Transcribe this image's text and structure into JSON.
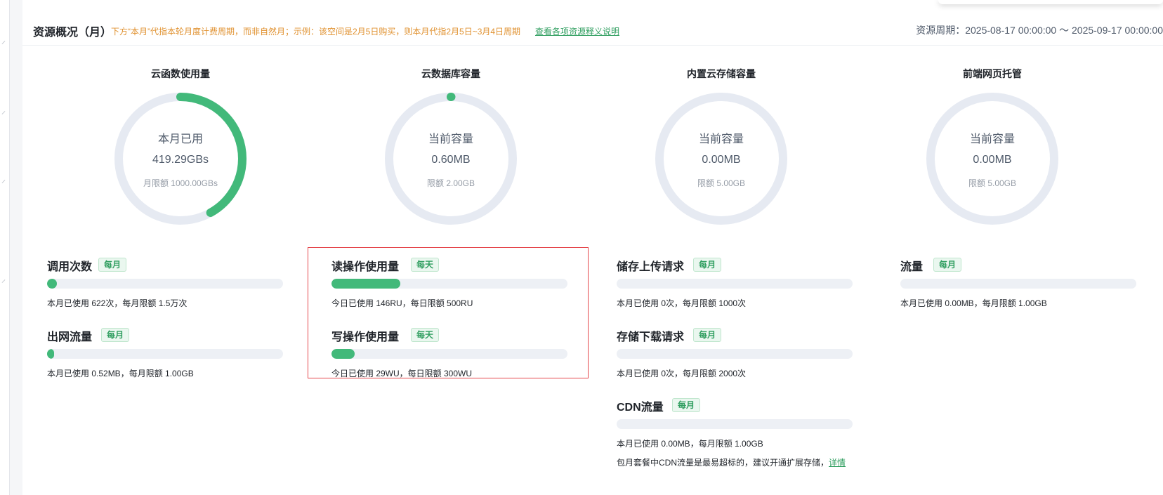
{
  "header": {
    "title": "资源概况（月）",
    "hint": "下方“本月”代指本轮月度计费周期，而非自然月；示例：该空间是2月5日购买，则本月代指2月5日~3月4日周期",
    "hint_link": "查看各项资源释义说明",
    "period": "资源周期：2025-08-17 00:00:00 ～ 2025-09-17 00:00:00"
  },
  "gauges": [
    {
      "title": "云函数使用量",
      "label": "本月已用",
      "value": "419.29GBs",
      "limit": "月限额 1000.00GBs",
      "fraction": 0.4193
    },
    {
      "title": "云数据库容量",
      "label": "当前容量",
      "value": "0.60MB",
      "limit": "限额 2.00GB",
      "fraction": 0.0003
    },
    {
      "title": "内置云存储容量",
      "label": "当前容量",
      "value": "0.00MB",
      "limit": "限额 5.00GB",
      "fraction": 0
    },
    {
      "title": "前端网页托管",
      "label": "当前容量",
      "value": "0.00MB",
      "limit": "限额 5.00GB",
      "fraction": 0
    }
  ],
  "metrics": {
    "calls": {
      "name": "调用次数",
      "badge": "每月",
      "desc": "本月已使用 622次，每月限额 1.5万次",
      "fraction": 0.041
    },
    "egress": {
      "name": "出网流量",
      "badge": "每月",
      "desc": "本月已使用 0.52MB，每月限额 1.00GB",
      "fraction": 0.0005
    },
    "read_ops": {
      "name": "读操作使用量",
      "badge": "每天",
      "desc": "今日已使用 146RU，每日限额 500RU",
      "fraction": 0.292
    },
    "write_ops": {
      "name": "写操作使用量",
      "badge": "每天",
      "desc": "今日已使用 29WU，每日限额 300WU",
      "fraction": 0.097
    },
    "upload_req": {
      "name": "储存上传请求",
      "badge": "每月",
      "desc": "本月已使用 0次，每月限额 1000次",
      "fraction": 0
    },
    "download_req": {
      "name": "存储下载请求",
      "badge": "每月",
      "desc": "本月已使用 0次，每月限额 2000次",
      "fraction": 0
    },
    "cdn": {
      "name": "CDN流量",
      "badge": "每月",
      "desc": "本月已使用 0.00MB，每月限额 1.00GB",
      "fraction": 0
    },
    "traffic": {
      "name": "流量",
      "badge": "每月",
      "desc": "本月已使用 0.00MB，每月限额 1.00GB",
      "fraction": 0
    }
  },
  "cdn_note": {
    "text": "包月套餐中CDN流量是最易超标的，建议开通扩展存储，",
    "link": "详情"
  },
  "colors": {
    "accent": "#42b97a",
    "track": "#e6eaf2",
    "warning_text": "#e0912f",
    "highlight_border": "#e5484d"
  }
}
